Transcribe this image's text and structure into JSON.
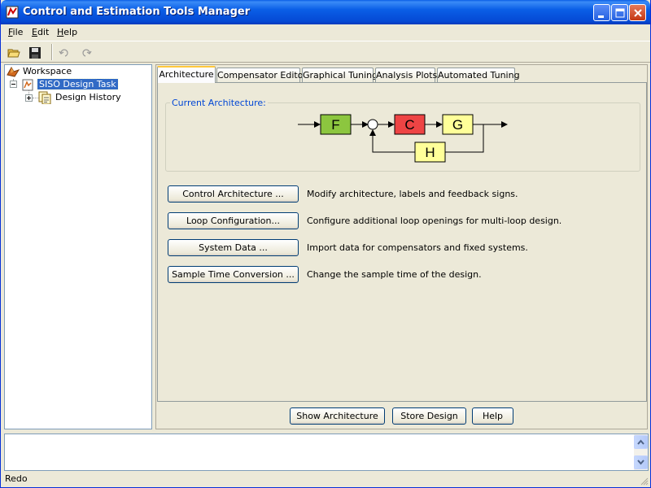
{
  "window": {
    "title": "Control and Estimation Tools Manager"
  },
  "menu": {
    "items": [
      {
        "label": "File",
        "mnemonic": "F",
        "rest": "ile"
      },
      {
        "label": "Edit",
        "mnemonic": "E",
        "rest": "dit"
      },
      {
        "label": "Help",
        "mnemonic": "H",
        "rest": "elp"
      }
    ]
  },
  "toolbar": {
    "icons": [
      "open-folder-icon",
      "save-disk-icon",
      "undo-icon",
      "redo-icon"
    ]
  },
  "tree": {
    "root": "Workspace",
    "task": "SISO Design Task",
    "child": "Design History"
  },
  "tabs": [
    {
      "label": "Architecture",
      "active": true
    },
    {
      "label": "Compensator Editor",
      "active": false
    },
    {
      "label": "Graphical Tuning",
      "active": false
    },
    {
      "label": "Analysis Plots",
      "active": false
    },
    {
      "label": "Automated Tuning",
      "active": false
    }
  ],
  "architecture": {
    "group_title": "Current Architecture:",
    "blocks": {
      "F": {
        "label": "F",
        "color": "#8cc63f"
      },
      "C": {
        "label": "C",
        "color": "#ee4444"
      },
      "G": {
        "label": "G",
        "color": "#ffff99"
      },
      "H": {
        "label": "H",
        "color": "#ffff99"
      }
    }
  },
  "actions": [
    {
      "button": "Control Architecture ...",
      "description": "Modify architecture, labels and feedback signs."
    },
    {
      "button": "Loop Configuration...",
      "description": "Configure additional loop openings for multi-loop design."
    },
    {
      "button": "System Data ...",
      "description": "Import data for compensators and fixed systems."
    },
    {
      "button": "Sample Time Conversion ...",
      "description": "Change the sample time of the design."
    }
  ],
  "bottom_buttons": {
    "show_architecture": "Show Architecture",
    "store_design": "Store Design",
    "help": "Help"
  },
  "status": {
    "text": "Redo"
  },
  "colors": {
    "title_bar": "#0a5ee6",
    "selection": "#316ac5",
    "group_title": "#0046d5",
    "active_tab_accent": "#ffc83c"
  }
}
